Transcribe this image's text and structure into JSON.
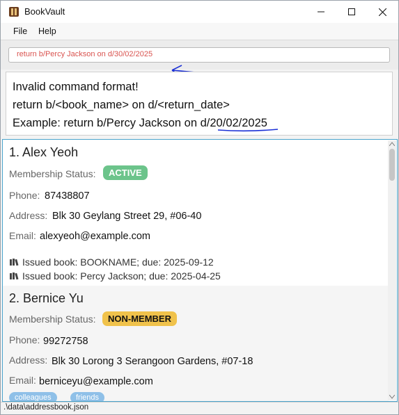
{
  "window": {
    "title": "BookVault"
  },
  "menu": {
    "file": "File",
    "help": "Help"
  },
  "command": {
    "value": "return b/Percy Jackson on d/30/02/2025"
  },
  "result": {
    "lines": [
      "Invalid command format!",
      "return b/<book_name> on d/<return_date>",
      "Example: return b/Percy Jackson on d/20/02/2025"
    ]
  },
  "persons": [
    {
      "index_name": "1.  Alex Yeoh",
      "membership_label": "Membership Status:",
      "membership": "ACTIVE",
      "phone_label": "Phone:",
      "phone": "87438807",
      "address_label": "Address:",
      "address": "Blk 30 Geylang Street 29, #06-40",
      "email_label": "Email:",
      "email": "alexyeoh@example.com",
      "issued": [
        "Issued book: BOOKNAME; due: 2025-09-12",
        "Issued book: Percy Jackson; due: 2025-04-25"
      ]
    },
    {
      "index_name": "2.  Bernice Yu",
      "membership_label": "Membership Status:",
      "membership": "NON-MEMBER",
      "phone_label": "Phone:",
      "phone": "99272758",
      "address_label": "Address:",
      "address": "Blk 30 Lorong 3 Serangoon Gardens, #07-18",
      "email_label": "Email:",
      "email": "berniceyu@example.com",
      "tags": [
        "colleagues",
        "friends"
      ]
    }
  ],
  "status": {
    "path": ".\\data\\addressbook.json"
  },
  "colors": {
    "active_badge": "#6cc48b",
    "nonmember_badge": "#f0c24b",
    "command_text": "#d9534f",
    "annotation": "#1a2fd6",
    "list_border": "#4aa3cc"
  }
}
